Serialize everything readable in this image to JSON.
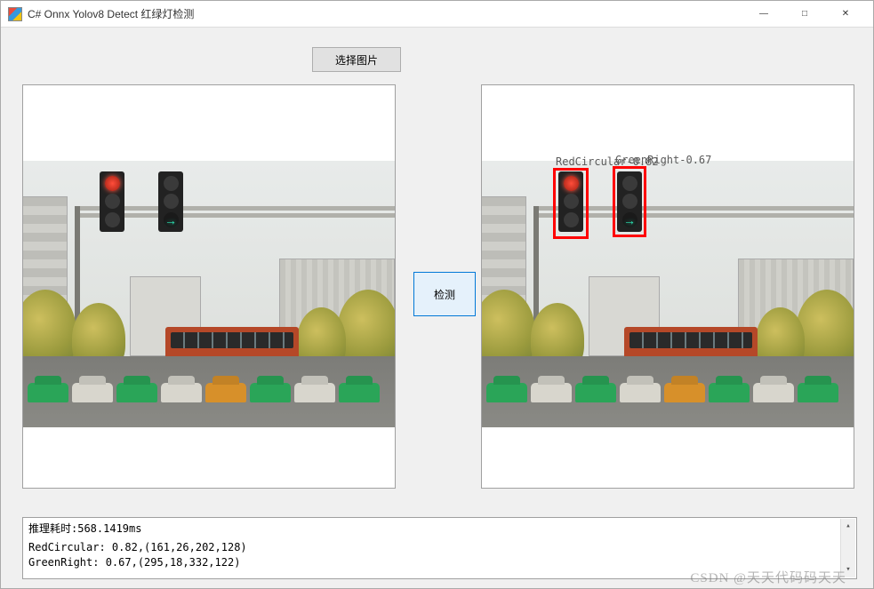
{
  "window": {
    "title": "C# Onnx Yolov8 Detect 红绿灯检测"
  },
  "buttons": {
    "select_image": "选择图片",
    "detect": "检测"
  },
  "detections": [
    {
      "label": "RedCircular-0.82",
      "box_css": "top:93px;left:80px;width:40px;height:80px;"
    },
    {
      "label": "GreenRight-0.67",
      "box_css": "top:91px;left:147px;width:38px;height:80px;"
    }
  ],
  "output": {
    "line1": "推理耗时:568.1419ms",
    "line2": "RedCircular: 0.82,(161,26,202,128)",
    "line3": "GreenRight: 0.67,(295,18,332,122)"
  },
  "watermark": "CSDN @天天代码码天天"
}
